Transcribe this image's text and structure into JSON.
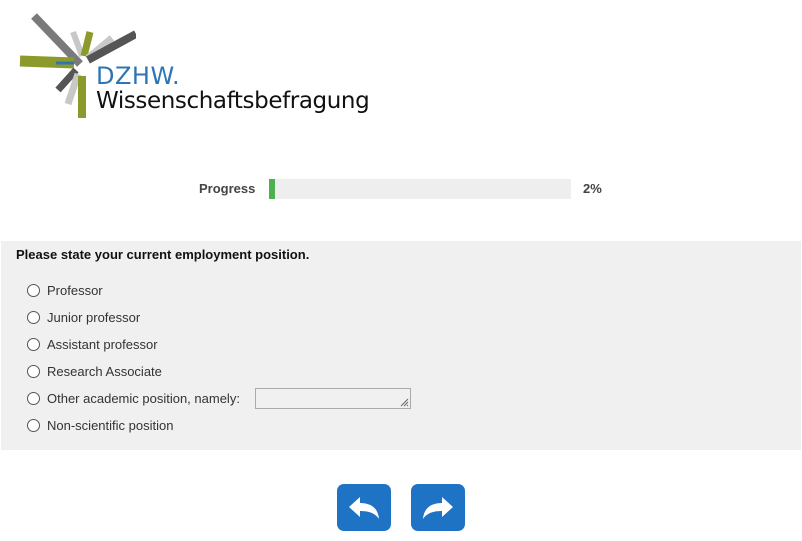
{
  "logo": {
    "brand": "DZHW.",
    "subtitle": "Wissenschaftsbefragung",
    "colors": {
      "olive": "#8c9a2c",
      "gray": "#7a7a7a",
      "dark": "#3a3a3a",
      "light": "#c8c8c8",
      "blue": "#2e75b6"
    }
  },
  "progress": {
    "label": "Progress",
    "value_text": "2%",
    "fraction": 0.02,
    "fill_color": "#4caf50"
  },
  "question": {
    "title": "Please state your current employment position.",
    "options": [
      {
        "label": "Professor"
      },
      {
        "label": "Junior professor"
      },
      {
        "label": "Assistant professor"
      },
      {
        "label": "Research Associate"
      },
      {
        "label": "Other academic position, namely:"
      },
      {
        "label": "Non-scientific position"
      }
    ],
    "other_value": ""
  },
  "navigation": {
    "back_icon": "arrow-back-icon",
    "next_icon": "arrow-next-icon",
    "button_color": "#1f73c4"
  }
}
